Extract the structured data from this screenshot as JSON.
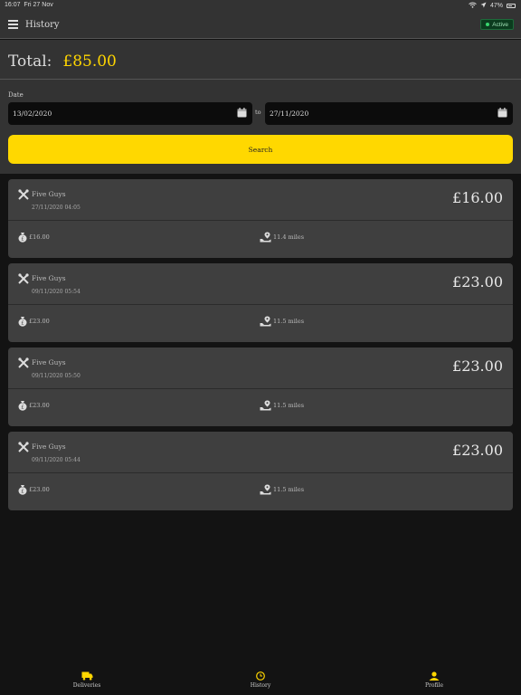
{
  "status_bar": {
    "time": "16:07",
    "date": "Fri 27 Nov",
    "battery": "47%"
  },
  "header": {
    "title": "History",
    "status": "Active"
  },
  "summary": {
    "total_label": "Total:",
    "total_amount": "£85.00"
  },
  "filters": {
    "date_label": "Date",
    "from_date": "13/02/2020",
    "to_label": "to",
    "to_date": "27/11/2020",
    "search_label": "Search"
  },
  "deliveries": [
    {
      "venue": "Five Guys",
      "datetime": "27/11/2020 04:05",
      "amount": "£16.00",
      "earnings": "£16.00",
      "distance": "11.4 miles"
    },
    {
      "venue": "Five Guys",
      "datetime": "09/11/2020 05:54",
      "amount": "£23.00",
      "earnings": "£23.00",
      "distance": "11.5 miles"
    },
    {
      "venue": "Five Guys",
      "datetime": "09/11/2020 05:50",
      "amount": "£23.00",
      "earnings": "£23.00",
      "distance": "11.5 miles"
    },
    {
      "venue": "Five Guys",
      "datetime": "09/11/2020 05:44",
      "amount": "£23.00",
      "earnings": "£23.00",
      "distance": "11.5 miles"
    }
  ],
  "tabs": [
    {
      "label": "Deliveries",
      "icon": "truck-icon"
    },
    {
      "label": "History",
      "icon": "clock-icon"
    },
    {
      "label": "Profile",
      "icon": "user-icon"
    }
  ],
  "colors": {
    "accent": "#ffd800",
    "background": "#131313",
    "panel": "#333333",
    "card": "#3f3f3f",
    "active_badge": "#38d46d"
  }
}
